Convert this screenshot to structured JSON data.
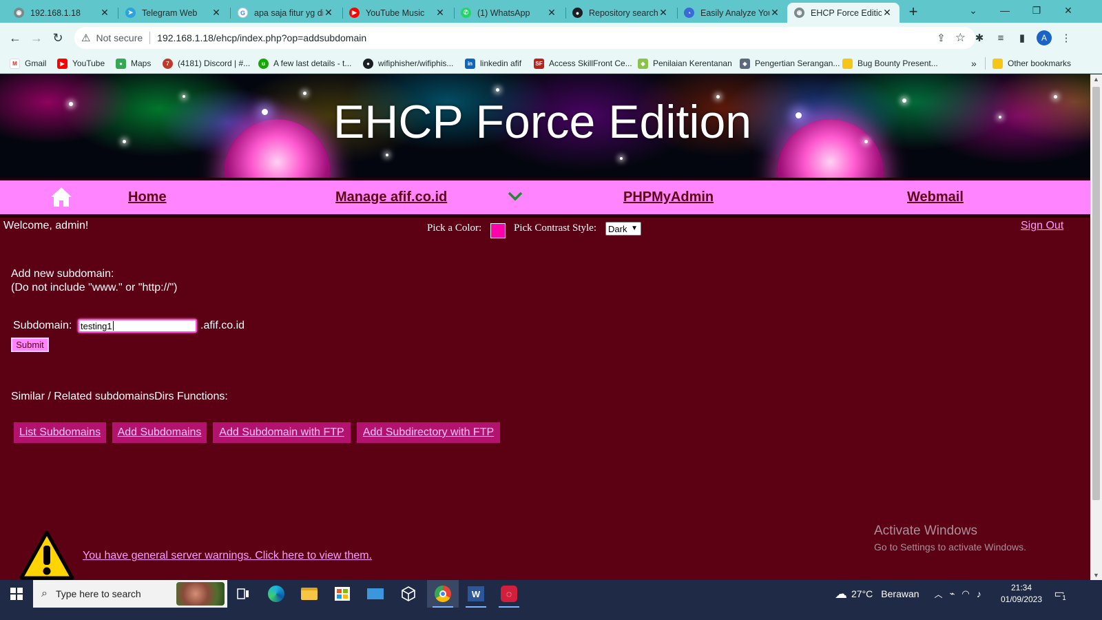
{
  "browser": {
    "tabs": [
      {
        "title": "192.168.1.18",
        "icon": "globe-icon"
      },
      {
        "title": "Telegram Web",
        "icon": "telegram-icon"
      },
      {
        "title": "apa saja fitur yg dit",
        "icon": "google-icon"
      },
      {
        "title": "YouTube Music",
        "icon": "youtube-music-icon"
      },
      {
        "title": "(1) WhatsApp",
        "icon": "whatsapp-icon"
      },
      {
        "title": "Repository search r",
        "icon": "github-icon"
      },
      {
        "title": "Easily Analyze Your",
        "icon": "analyze-icon"
      },
      {
        "title": "EHCP Force Edition",
        "icon": "globe-icon",
        "active": true
      }
    ],
    "new_tab": "+",
    "address": {
      "security": "Not secure",
      "url": "192.168.1.18/ehcp/index.php?op=addsubdomain"
    },
    "profile_initial": "A",
    "bookmarks": [
      {
        "label": "Gmail",
        "icon": "gmail-icon"
      },
      {
        "label": "YouTube",
        "icon": "youtube-icon"
      },
      {
        "label": "Maps",
        "icon": "maps-icon"
      },
      {
        "label": "(4181) Discord | #...",
        "icon": "discord-icon"
      },
      {
        "label": "A few last details - t...",
        "icon": "upwork-icon"
      },
      {
        "label": "wifiphisher/wifiphis...",
        "icon": "github-icon"
      },
      {
        "label": "linkedin afif",
        "icon": "linkedin-icon"
      },
      {
        "label": "Access SkillFront Ce...",
        "icon": "skillfront-icon"
      },
      {
        "label": "Penilaian Kerentanan",
        "icon": "cube-icon"
      },
      {
        "label": "Pengertian Serangan...",
        "icon": "shield-icon"
      },
      {
        "label": "Bug Bounty Present...",
        "icon": "folder-icon"
      }
    ],
    "bookmarks_more": "»",
    "other_bookmarks": "Other bookmarks"
  },
  "page": {
    "banner_title": "EHCP Force Edition",
    "nav": {
      "home": "Home",
      "manage": "Manage afif.co.id",
      "phpmyadmin": "PHPMyAdmin",
      "webmail": "Webmail"
    },
    "welcome": "Welcome, admin!",
    "pick_color_label": "Pick a Color:",
    "pick_color_value": "#ff00aa",
    "contrast_label": "Pick Contrast Style:",
    "contrast_value": "Dark",
    "sign_out": "Sign Out",
    "add_heading_line1": "Add new subdomain:",
    "add_heading_line2": "(Do not include \"www.\" or \"http://\")",
    "subdomain_label": "Subdomain:",
    "subdomain_value": "testing1",
    "subdomain_suffix": ".afif.co.id",
    "submit_label": "Submit",
    "related_heading": "Similar / Related subdomainsDirs Functions:",
    "related_links": [
      "List Subdomains",
      "Add Subdomains",
      "Add Subdomain with FTP",
      "Add Subdirectory with FTP"
    ],
    "warning_link": "You have general server warnings. Click here to view them."
  },
  "watermark": {
    "line1": "Activate Windows",
    "line2": "Go to Settings to activate Windows."
  },
  "taskbar": {
    "search_placeholder": "Type here to search",
    "weather_temp": "27°C",
    "weather_desc": "Berawan",
    "time": "21:34",
    "date": "01/09/2023",
    "notification_count": "1"
  },
  "colors": {
    "page_bg": "#5c0013",
    "nav_bg": "#ff84ff",
    "accent": "#ff00aa",
    "link": "#ff9bff"
  }
}
